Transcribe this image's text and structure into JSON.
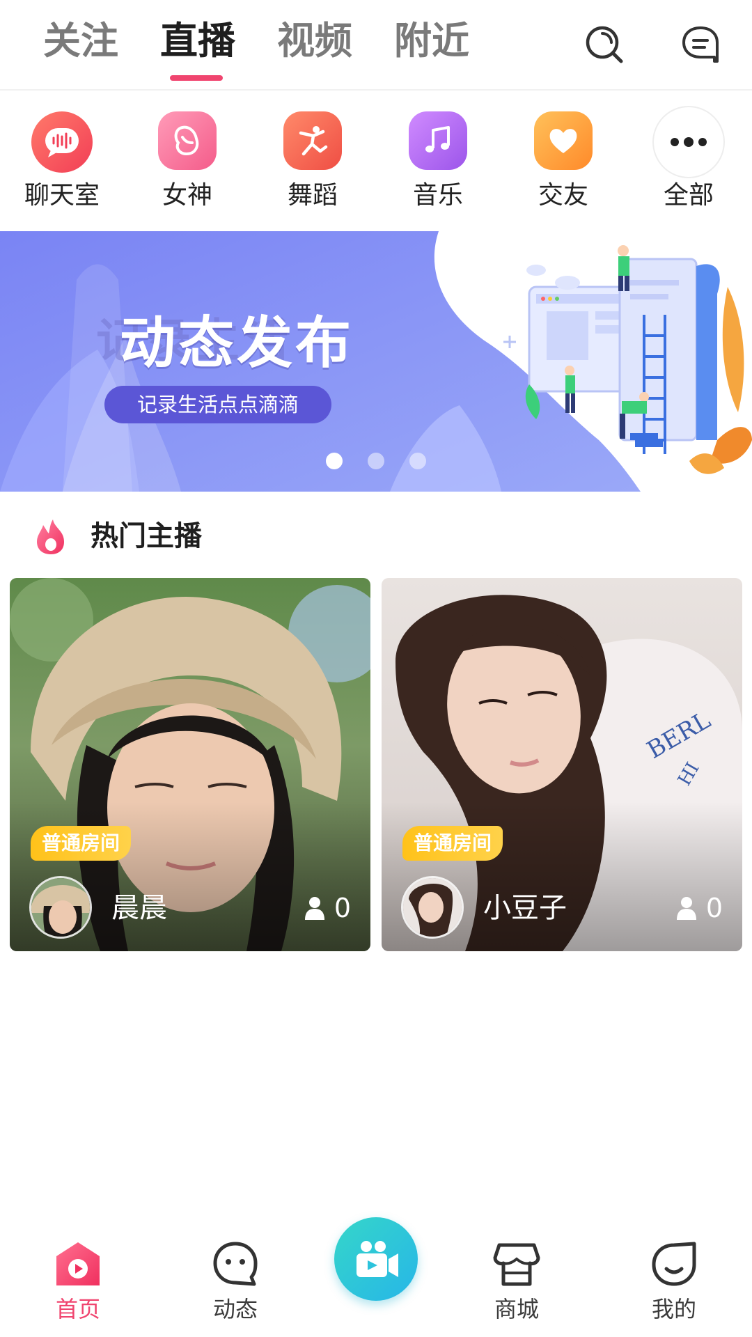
{
  "top_tabs": {
    "items": [
      {
        "label": "关注",
        "active": false
      },
      {
        "label": "直播",
        "active": true
      },
      {
        "label": "视频",
        "active": false
      },
      {
        "label": "附近",
        "active": false
      }
    ],
    "icons": [
      "search-icon",
      "message-icon"
    ],
    "accent_color": "#f0456f"
  },
  "categories": [
    {
      "label": "聊天室",
      "icon": "voice-wave-icon",
      "color": "#f5485a"
    },
    {
      "label": "女神",
      "icon": "goddess-icon",
      "color": "#f7749a"
    },
    {
      "label": "舞蹈",
      "icon": "dance-icon",
      "color": "#f56a50"
    },
    {
      "label": "音乐",
      "icon": "music-note-icon",
      "color": "#b467f0"
    },
    {
      "label": "交友",
      "icon": "heart-icon",
      "color": "#ffa33a"
    },
    {
      "label": "全部",
      "icon": "more-dots-icon",
      "color": "#ffffff"
    }
  ],
  "banner": {
    "title": "动态发布",
    "ghost_text": "记录生活",
    "subtitle": "记录生活点点滴滴",
    "slides": 3,
    "active_slide": 0,
    "colors": [
      "#7a86f5",
      "#8e9cf7"
    ]
  },
  "section": {
    "title": "热门主播",
    "icon": "flame-icon"
  },
  "anchors": [
    {
      "room_tag": "普通房间",
      "name": "晨晨",
      "viewers": "0"
    },
    {
      "room_tag": "普通房间",
      "name": "小豆子",
      "viewers": "0"
    }
  ],
  "bottom_nav": {
    "items": [
      {
        "label": "首页",
        "icon": "home-play-icon",
        "active": true
      },
      {
        "label": "动态",
        "icon": "chat-face-icon",
        "active": false
      },
      {
        "label": "商城",
        "icon": "store-icon",
        "active": false
      },
      {
        "label": "我的",
        "icon": "profile-face-icon",
        "active": false
      }
    ],
    "center_icon": "live-camera-icon"
  }
}
